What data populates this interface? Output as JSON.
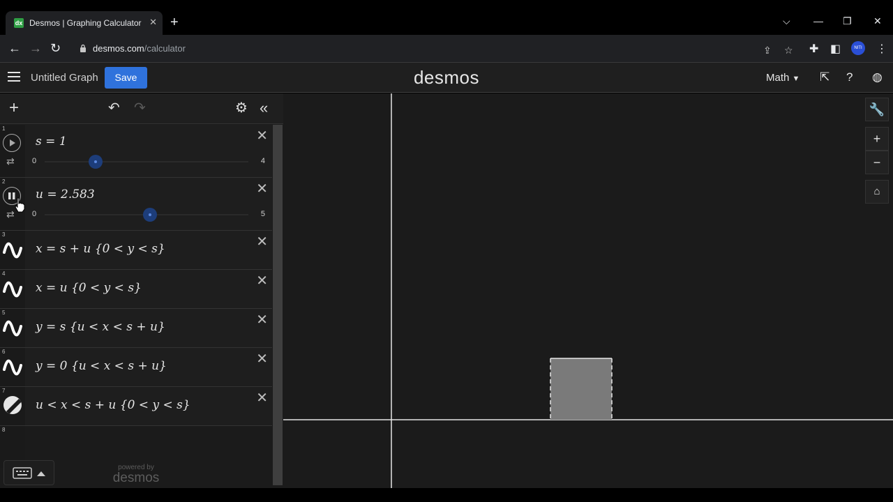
{
  "browser": {
    "tab_title": "Desmos | Graphing Calculator",
    "favicon_letters": "dx",
    "url_host": "desmos.com",
    "url_path": "/calculator",
    "profile_label": "NITI"
  },
  "header": {
    "graph_title": "Untitled Graph",
    "save_label": "Save",
    "logo": "desmos",
    "math_menu": "Math"
  },
  "expressions": [
    {
      "index": "1",
      "kind": "slider",
      "latex": "s = 1",
      "min": "0",
      "max": "4",
      "value": 1,
      "range": [
        0,
        4
      ],
      "playing": false
    },
    {
      "index": "2",
      "kind": "slider",
      "latex": "u = 2.583",
      "min": "0",
      "max": "5",
      "value": 2.583,
      "range": [
        0,
        5
      ],
      "playing": true
    },
    {
      "index": "3",
      "kind": "curve",
      "latex": "x = s + u {0 < y < s}"
    },
    {
      "index": "4",
      "kind": "curve",
      "latex": "x = u {0 < y < s}"
    },
    {
      "index": "5",
      "kind": "curve",
      "latex": "y = s {u < x < s + u}"
    },
    {
      "index": "6",
      "kind": "curve",
      "latex": "y = 0 {u < x < s + u}"
    },
    {
      "index": "7",
      "kind": "region",
      "latex": "u < x < s + u {0 < y < s}"
    },
    {
      "index": "8",
      "kind": "empty",
      "latex": ""
    }
  ],
  "footer": {
    "powered_by": "powered by",
    "powered_brand": "desmos"
  },
  "colors": {
    "accent": "#2f72dc",
    "shape_fill": "#7a7a7a",
    "axis": "#e6e6e6"
  }
}
